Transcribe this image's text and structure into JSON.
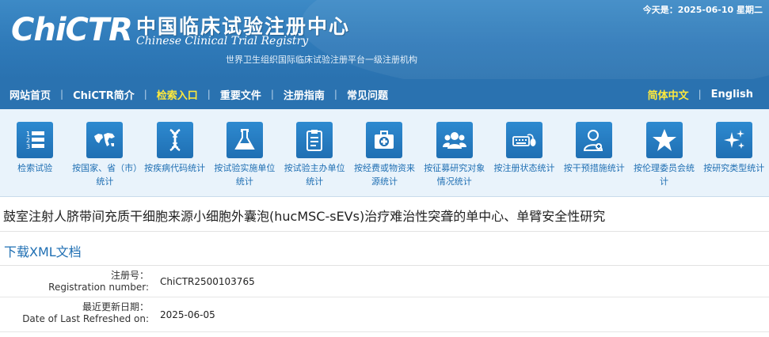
{
  "header": {
    "logo_text": "ChiCTR",
    "title_cn": "中国临床试验注册中心",
    "title_en": "Chinese Clinical Trial Registry",
    "subtitle": "世界卫生组织国际临床试验注册平台一级注册机构",
    "today": "今天是：2025-06-10 星期二"
  },
  "nav": {
    "items": [
      {
        "label": "网站首页",
        "active": false
      },
      {
        "label": "ChiCTR简介",
        "active": false
      },
      {
        "label": "检索入口",
        "active": true
      },
      {
        "label": "重要文件",
        "active": false
      },
      {
        "label": "注册指南",
        "active": false
      },
      {
        "label": "常见问题",
        "active": false
      }
    ],
    "lang_cn": "简体中文",
    "lang_en": "English"
  },
  "icons": [
    {
      "icon": "list-numbered-icon",
      "label": "检索试验"
    },
    {
      "icon": "world-map-icon",
      "label": "按国家、省（市）统计"
    },
    {
      "icon": "dna-icon",
      "label": "按疾病代码统计"
    },
    {
      "icon": "flask-icon",
      "label": "按试验实施单位统计"
    },
    {
      "icon": "clipboard-icon",
      "label": "按试验主办单位统计"
    },
    {
      "icon": "medical-kit-icon",
      "label": "按经费或物资来源统计"
    },
    {
      "icon": "group-people-icon",
      "label": "按征募研究对象情况统计"
    },
    {
      "icon": "keyboard-mouse-icon",
      "label": "按注册状态统计"
    },
    {
      "icon": "doctor-icon",
      "label": "按干预措施统计"
    },
    {
      "icon": "star-icon",
      "label": "按伦理委员会统计"
    },
    {
      "icon": "sparkle-icon",
      "label": "按研究类型统计"
    }
  ],
  "main": {
    "title": "鼓室注射人脐带间充质干细胞来源小细胞外囊泡(hucMSC-sEVs)治疗难治性突聋的单中心、单臂安全性研究",
    "download_label": "下载XML文档",
    "fields": [
      {
        "label_cn": "注册号：",
        "label_en": "Registration number:",
        "value": "ChiCTR2500103765"
      },
      {
        "label_cn": "最近更新日期：",
        "label_en": "Date of Last Refreshed on:",
        "value": "2025-06-05"
      }
    ]
  },
  "colors": {
    "header_blue": "#2f7ab9",
    "nav_blue": "#2a72b0",
    "active_yellow": "#ffe93b",
    "link_blue": "#1f6fb3",
    "iconbar_bg": "#e9f3fb"
  }
}
